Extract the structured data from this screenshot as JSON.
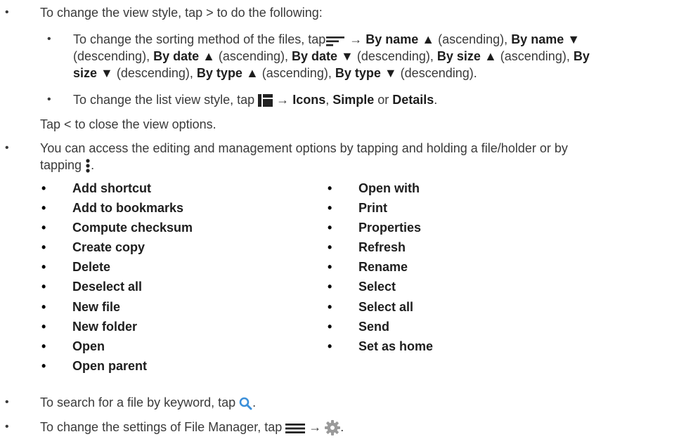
{
  "bullets": {
    "view_style": "To change the view style, tap > to do the following:",
    "sort_line1_pre": "To change the sorting method of the files, tap",
    "sort_line1_arrow": "→",
    "sort_line1_b1": "By name ▲",
    "sort_line1_t1": " (ascending), ",
    "sort_line1_b2": "By name ▼",
    "sort_line2_t1": "(descending), ",
    "sort_line2_b1": "By date ▲",
    "sort_line2_t2": " (ascending), ",
    "sort_line2_b2": "By date ▼",
    "sort_line2_t3": " (descending), ",
    "sort_line2_b3": "By size ▲",
    "sort_line2_t4": " (ascending), ",
    "sort_line2_b4": "By",
    "sort_line3_b1": "size ▼",
    "sort_line3_t1": " (descending), ",
    "sort_line3_b2": "By type ▲",
    "sort_line3_t2": " (ascending), ",
    "sort_line3_b3": "By type ▼",
    "sort_line3_t3": " (descending).",
    "list_view_pre": "To change the list view style, tap",
    "list_view_arrow": "→",
    "list_view_icons": "Icons",
    "list_view_comma": ", ",
    "list_view_simple": "Simple",
    "list_view_or": " or ",
    "list_view_details": "Details",
    "list_view_end": ".",
    "close_view": "Tap < to close the view options.",
    "edit_line1": "You can access the editing and management options by tapping and holding a file/holder or by",
    "edit_line2": "tapping",
    "edit_line2_end": ".",
    "search_pre": "To search for a file by keyword, tap",
    "search_end": ".",
    "settings_pre": "To change the settings of File Manager, tap",
    "settings_arrow": "→",
    "settings_end": "."
  },
  "options_left": [
    "Add shortcut",
    "Add to bookmarks",
    "Compute checksum",
    "Create copy",
    "Delete",
    "Deselect all",
    "New file",
    "New folder",
    "Open",
    "Open parent"
  ],
  "options_right": [
    "Open with",
    "Print",
    "Properties",
    "Refresh",
    "Rename",
    "Select",
    "Select all",
    "Send",
    "Set as home"
  ],
  "bullet_char": "•",
  "icons": {
    "sort": "sort-lines-icon",
    "list_view": "grid-view-icon",
    "more": "vertical-dots-icon",
    "search": "search-icon",
    "menu": "hamburger-menu-icon",
    "settings": "gear-icon"
  },
  "colors": {
    "accent_blue": "#3b8fd9",
    "gear_gray": "#9a9a9a"
  }
}
